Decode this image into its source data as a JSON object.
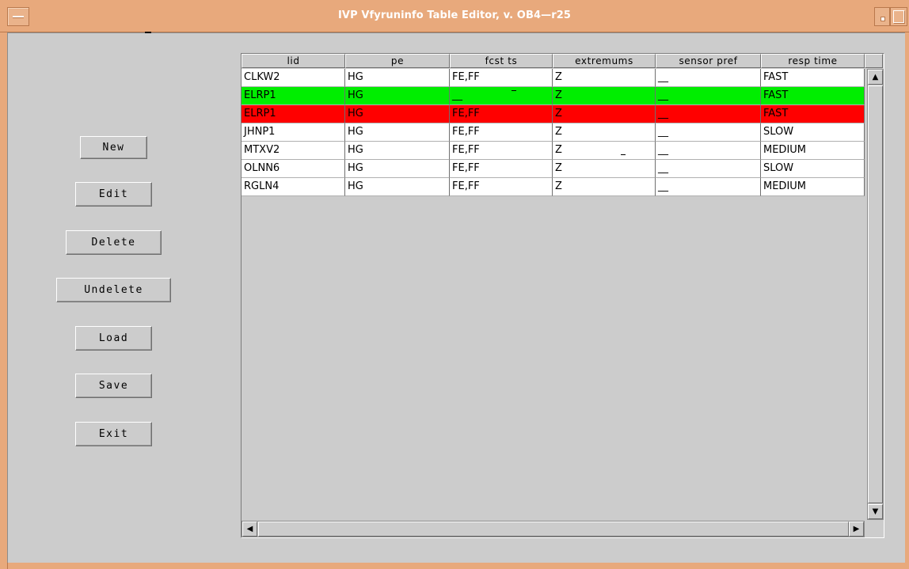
{
  "window": {
    "title": "IVP Vfyruninfo Table Editor, v. OB4—r25"
  },
  "buttons": {
    "new": "New",
    "edit": "Edit",
    "delete": "Delete",
    "undelete": "Undelete",
    "load": "Load",
    "save": "Save",
    "exit": "Exit"
  },
  "table": {
    "columns": [
      "lid",
      "pe",
      "fcst ts",
      "extremums",
      "sensor pref",
      "resp time"
    ],
    "rows": [
      {
        "lid": "CLKW2",
        "pe": "HG",
        "fcst_ts": "FE,FF",
        "extremums": "Z",
        "sensor_pref": "__",
        "resp_time": "FAST",
        "highlight": "none"
      },
      {
        "lid": "ELRP1",
        "pe": "HG",
        "fcst_ts": "__",
        "extremums": "Z",
        "sensor_pref": "__",
        "resp_time": "FAST",
        "highlight": "green"
      },
      {
        "lid": "ELRP1",
        "pe": "HG",
        "fcst_ts": "FE,FF",
        "extremums": "Z",
        "sensor_pref": "__",
        "resp_time": "FAST",
        "highlight": "red"
      },
      {
        "lid": "JHNP1",
        "pe": "HG",
        "fcst_ts": "FE,FF",
        "extremums": "Z",
        "sensor_pref": "__",
        "resp_time": "SLOW",
        "highlight": "none"
      },
      {
        "lid": "MTXV2",
        "pe": "HG",
        "fcst_ts": "FE,FF",
        "extremums": "Z",
        "sensor_pref": "__",
        "resp_time": "MEDIUM",
        "highlight": "none"
      },
      {
        "lid": "OLNN6",
        "pe": "HG",
        "fcst_ts": "FE,FF",
        "extremums": "Z",
        "sensor_pref": "__",
        "resp_time": "SLOW",
        "highlight": "none"
      },
      {
        "lid": "RGLN4",
        "pe": "HG",
        "fcst_ts": "FE,FF",
        "extremums": "Z",
        "sensor_pref": "__",
        "resp_time": "MEDIUM",
        "highlight": "none"
      }
    ]
  },
  "colors": {
    "titlebar": "#e8a97c",
    "panel": "#cccccc",
    "row_green": "#00ee00",
    "row_red": "#ff0000"
  },
  "icons": {
    "window_menu": "window-menu-icon",
    "minimize": "minimize-icon",
    "maximize": "maximize-icon",
    "scroll_up": "arrow-up-icon",
    "scroll_down": "arrow-down-icon",
    "scroll_left": "arrow-left-icon",
    "scroll_right": "arrow-right-icon"
  }
}
